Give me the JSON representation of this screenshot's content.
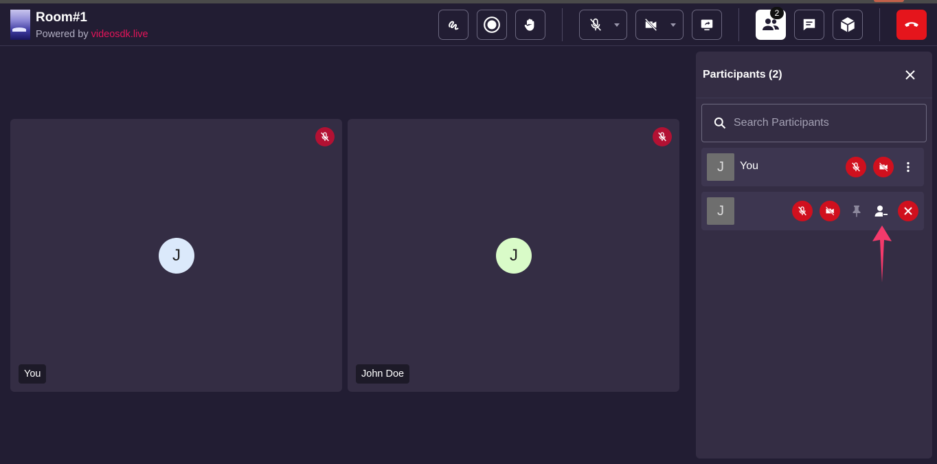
{
  "room": {
    "title": "Room#1",
    "powered_prefix": "Powered by",
    "powered_brand": "videosdk.live"
  },
  "toolbar": {
    "participant_count": "2",
    "icons": [
      "whiteboard-icon",
      "record-icon",
      "raise-hand-icon",
      "mic-off-icon",
      "video-off-icon",
      "screen-share-icon",
      "participants-icon",
      "chat-icon",
      "meeting-cube-icon",
      "end-call-icon"
    ]
  },
  "tiles": [
    {
      "initial": "J",
      "name": "You",
      "avatar_color": "#dbe9fb"
    },
    {
      "initial": "J",
      "name": "John Doe",
      "avatar_color": "#d9fbc8"
    }
  ],
  "panel": {
    "title": "Participants (2)",
    "search_placeholder": "Search Participants",
    "participants": [
      {
        "initial": "J",
        "name": "You"
      },
      {
        "initial": "J",
        "name": ""
      }
    ]
  },
  "colors": {
    "background": "#221d33",
    "tile": "#342d44",
    "danger": "#d0101e",
    "brand": "#e5145a",
    "arrow": "#f43a6b"
  }
}
